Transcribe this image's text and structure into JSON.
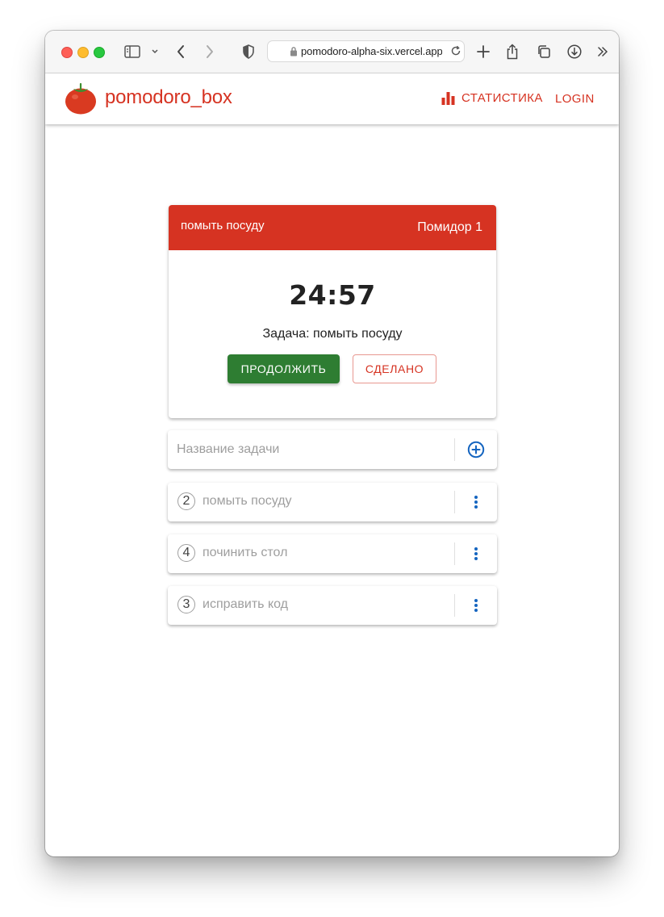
{
  "browser": {
    "url": "pomodoro-alpha-six.vercel.app"
  },
  "header": {
    "brand": "pomodoro_box",
    "nav_stats": "СТАТИСТИКА",
    "nav_login": "LOGIN"
  },
  "timer_card": {
    "task_title": "помыть посуду",
    "round_label": "Помидор 1",
    "time": "24:57",
    "task_line": "Задача: помыть посуду",
    "continue_label": "ПРОДОЛЖИТЬ",
    "done_label": "СДЕЛАНО"
  },
  "new_task": {
    "placeholder": "Название задачи",
    "value": ""
  },
  "tasks": [
    {
      "count": "2",
      "name": "помыть посуду"
    },
    {
      "count": "4",
      "name": "починить стол"
    },
    {
      "count": "3",
      "name": "исправить код"
    }
  ],
  "colors": {
    "brand_red": "#d63322",
    "continue_green": "#2e7d32",
    "icon_blue": "#1565c0"
  },
  "icons": {
    "logo": "tomato-logo-icon",
    "stats": "bar-chart-icon",
    "add": "add-circle-icon",
    "menu": "more-vert-icon"
  }
}
